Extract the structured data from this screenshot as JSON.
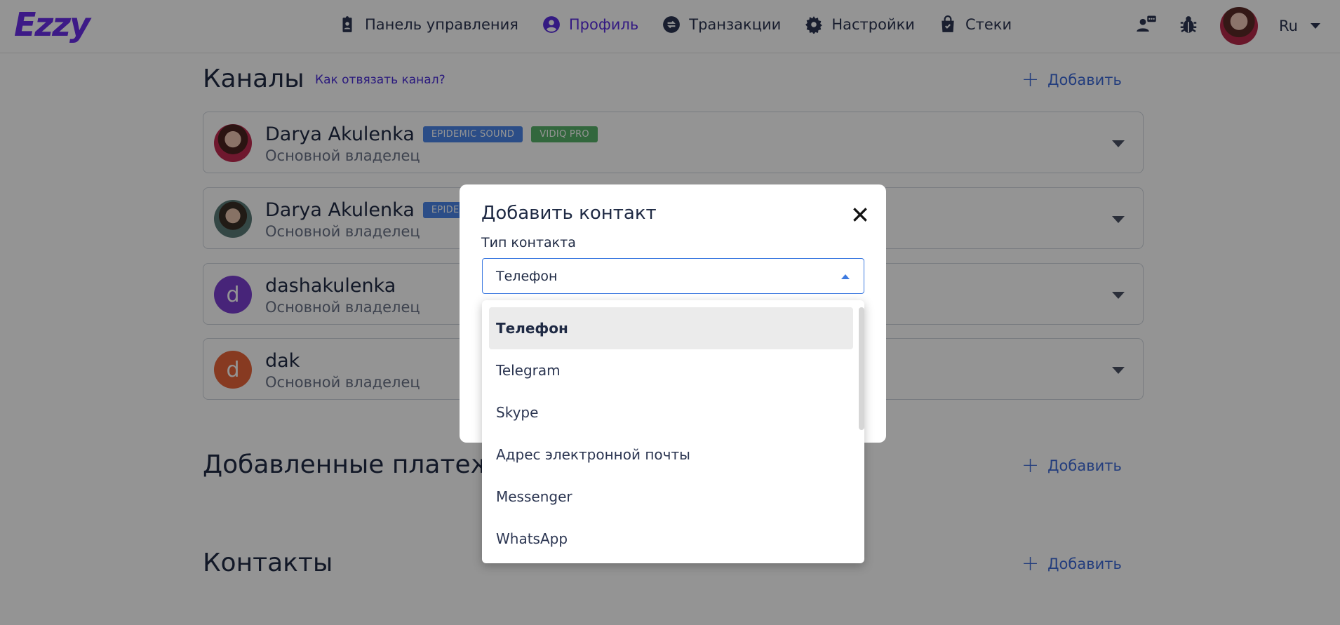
{
  "header": {
    "logo": "Ezzy",
    "nav": [
      {
        "label": "Панель управления",
        "icon": "clipboard-badge-icon",
        "active": false
      },
      {
        "label": "Профиль",
        "icon": "user-circle-icon",
        "active": true
      },
      {
        "label": "Транзакции",
        "icon": "exchange-icon",
        "active": false
      },
      {
        "label": "Настройки",
        "icon": "gear-icon",
        "active": false
      },
      {
        "label": "Стеки",
        "icon": "bag-icon",
        "active": false
      }
    ],
    "language": "Ru"
  },
  "channels_section": {
    "title": "Каналы",
    "help_link": "Как отвязать канал?",
    "add_label": "Добавить",
    "items": [
      {
        "name": "Darya Akulenka",
        "role": "Основной владелец",
        "badges": [
          "EPIDEMIC SOUND",
          "VIDIQ PRO"
        ]
      },
      {
        "name": "Darya Akulenka",
        "role": "Основной владелец",
        "badges": [
          "EPIDEMIC SOUND"
        ]
      },
      {
        "name": "dashakulenka",
        "role": "Основной владелец",
        "initial": "d"
      },
      {
        "name": "dak",
        "role": "Основной владелец",
        "initial": "d"
      }
    ]
  },
  "payments_section": {
    "title": "Добавленные платежные",
    "add_label": "Добавить"
  },
  "contacts_section": {
    "title": "Контакты",
    "add_label": "Добавить"
  },
  "modal": {
    "title": "Добавить контакт",
    "field_label": "Тип контакта",
    "selected_value": "Телефон",
    "options": [
      "Телефон",
      "Telegram",
      "Skype",
      "Адрес электронной почты",
      "Messenger",
      "WhatsApp"
    ]
  },
  "colors": {
    "accent": "#5b2ee0",
    "link_blue": "#3d6ad8",
    "badge_blue": "#4a86e8",
    "badge_green": "#57b26a",
    "avatar_purple": "#7a3fd0",
    "avatar_orange": "#e8643a"
  }
}
